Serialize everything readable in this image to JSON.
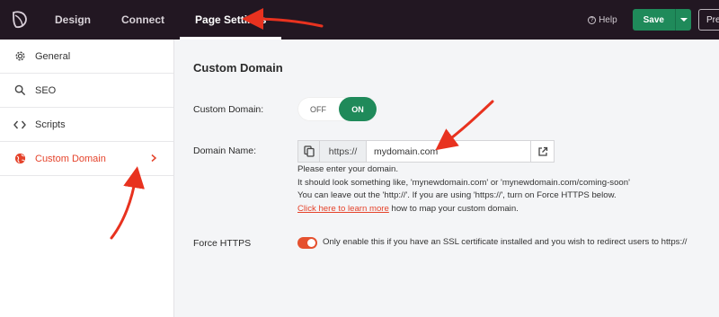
{
  "topbar": {
    "tabs": [
      {
        "label": "Design"
      },
      {
        "label": "Connect"
      },
      {
        "label": "Page Settings"
      }
    ],
    "help_label": "Help",
    "save_label": "Save",
    "preview_label": "Pre"
  },
  "sidebar": {
    "items": [
      {
        "label": "General",
        "icon": "gear-icon"
      },
      {
        "label": "SEO",
        "icon": "search-icon"
      },
      {
        "label": "Scripts",
        "icon": "code-icon"
      },
      {
        "label": "Custom Domain",
        "icon": "globe-icon",
        "active": true
      }
    ]
  },
  "main": {
    "title": "Custom Domain",
    "custom_domain": {
      "label": "Custom Domain:",
      "off_label": "OFF",
      "on_label": "ON",
      "state": "on"
    },
    "domain_name": {
      "label": "Domain Name:",
      "prefix": "https://",
      "value": "mydomain.com"
    },
    "help_lines": [
      "Please enter your domain.",
      "It should look something like, 'mynewdomain.com' or 'mynewdomain.com/coming-soon'",
      "You can leave out the 'http://'. If you are using 'https://', turn on Force HTTPS below."
    ],
    "help_link": "Click here to learn more",
    "help_link_suffix": " how to map your custom domain.",
    "force_https": {
      "label": "Force HTTPS",
      "enabled": true,
      "note": "Only enable this if you have an SSL certificate installed and you wish to redirect users to https://"
    }
  },
  "colors": {
    "topbar_bg": "#221722",
    "accent_green": "#1f8a5a",
    "accent_red": "#e5432b",
    "annotation_arrow": "#e8321f"
  }
}
